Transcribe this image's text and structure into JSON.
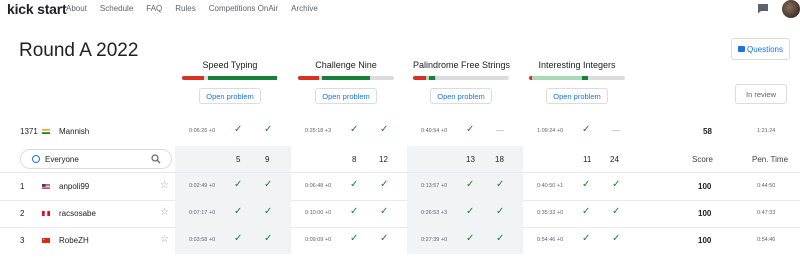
{
  "brand": "kick start",
  "nav": [
    "About",
    "Schedule",
    "FAQ",
    "Rules",
    "Competitions OnAir",
    "Archive"
  ],
  "title": "Round A 2022",
  "questions_label": "Questions",
  "review_label": "In review",
  "open_label": "Open problem",
  "colors": {
    "green": "#188038",
    "red": "#d93025",
    "lightgreen": "#a8dab5",
    "blue": "#1a73e8"
  },
  "problems": [
    {
      "name": "Speed Typing",
      "bar": {
        "red": 0.23,
        "green_dark": 0.72,
        "green_light": 0.0
      }
    },
    {
      "name": "Challenge Nine",
      "bar": {
        "red": 0.22,
        "green_dark": 0.5,
        "green_light": 0.0
      }
    },
    {
      "name": "Palindrome Free Strings",
      "bar": {
        "red": 0.14,
        "green_dark": 0.06,
        "green_light": 0.1
      }
    },
    {
      "name": "Interesting Integers",
      "bar": {
        "red": 0.03,
        "green_dark": 0.06,
        "green_light": 0.55
      }
    }
  ],
  "my_row": {
    "rank": "1371",
    "name": "Mannish",
    "times": [
      "0:06:26 +0",
      "0:25:18 +3",
      "0:49:54 +0",
      "1:09:24 +0"
    ],
    "dash": "—",
    "score": "58",
    "penalty": "1:21:24"
  },
  "header": {
    "filter_label": "Everyone",
    "counts": [
      "5",
      "9",
      "8",
      "12",
      "13",
      "18",
      "11",
      "24"
    ],
    "score_label": "Score",
    "penalty_label": "Pen. Time"
  },
  "rows": [
    {
      "rank": "1",
      "name": "anpoli99",
      "times": [
        "0:02:49 +0",
        "0:06:48 +0",
        "0:13:57 +0",
        "0:40:50 +1"
      ],
      "score": "100",
      "penalty": "0:44:50"
    },
    {
      "rank": "2",
      "name": "racsosabe",
      "times": [
        "0:07:17 +0",
        "0:10:00 +0",
        "0:26:53 +3",
        "0:35:33 +0"
      ],
      "score": "100",
      "penalty": "0:47:33"
    },
    {
      "rank": "3",
      "name": "RobeZH",
      "times": [
        "0:03:58 +0",
        "0:09:09 +0",
        "0:27:39 +0",
        "0:54:46 +0"
      ],
      "score": "100",
      "penalty": "0:54:46"
    }
  ],
  "icons": {
    "chat": "chat-icon",
    "search": "search-icon",
    "globe": "globe-icon",
    "star": "star-icon",
    "check": "check-icon"
  }
}
